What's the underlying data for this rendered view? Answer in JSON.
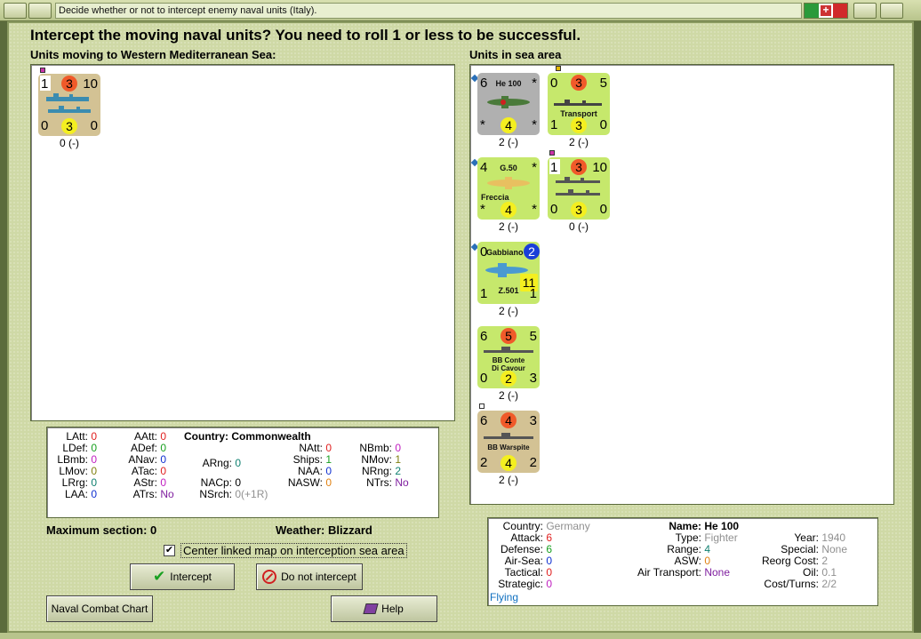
{
  "window": {
    "title": "Decide whether or not to intercept enemy naval units (Italy)."
  },
  "heading": "Intercept the moving naval units?  You need to roll 1 or less to be successful.",
  "left_panel_label": "Units moving to Western Mediterranean Sea:",
  "right_panel_label": "Units in sea area",
  "moving_units": [
    {
      "tl": "1",
      "tc": "3",
      "tr": "10",
      "bl": "0",
      "bc": "3",
      "br": "0",
      "label": "0 (-)"
    }
  ],
  "sea_units": [
    {
      "tl": "6",
      "tc": "",
      "tr": "*",
      "bl": "*",
      "bc": "4",
      "br": "*",
      "name": "He 100",
      "label": "2 (-)"
    },
    {
      "tl": "0",
      "tc": "3",
      "tr": "5",
      "bl": "1",
      "bc": "3",
      "br": "0",
      "name": "Transport",
      "label": "2 (-)"
    },
    {
      "tl": "4",
      "tc": "",
      "tr": "*",
      "bl": "*",
      "bc": "4",
      "br": "*",
      "name": "G.50",
      "name2": "Freccia",
      "label": "2 (-)"
    },
    {
      "tl": "1",
      "tc": "3",
      "tr": "10",
      "bl": "0",
      "bc": "3",
      "br": "0",
      "label": "0 (-)"
    },
    {
      "tl": "0",
      "tc": "2",
      "tr": "",
      "bl": "1",
      "bc": "11",
      "br": "1",
      "name": "Gabbiano",
      "name2": "Z.501",
      "label": "2 (-)"
    },
    {
      "tl": "6",
      "tc": "5",
      "tr": "5",
      "bl": "0",
      "bc": "2",
      "br": "3",
      "name": "BB Conte",
      "name2": "Di Cavour",
      "label": "2 (-)"
    },
    {
      "tl": "6",
      "tc": "4",
      "tr": "3",
      "bl": "2",
      "bc": "4",
      "br": "2",
      "name": "BB Warspite",
      "label": "2 (-)"
    }
  ],
  "summary": {
    "LAtt": "0",
    "LDef": "0",
    "LBmb": "0",
    "LMov": "0",
    "LRrg": "0",
    "LAA": "0",
    "AAtt": "0",
    "ADef": "0",
    "ANav": "0",
    "ATac": "0",
    "AStr": "0",
    "ATrs": "No",
    "country_label": "Country:",
    "country": "Commonwealth",
    "ARng": "0",
    "NACp": "0",
    "NSrch": "0(+1R)",
    "NAtt": "0",
    "Ships": "1",
    "NAA": "0",
    "NASW": "0",
    "NBmb": "0",
    "NMov": "1",
    "NRng": "2",
    "NTrs": "No"
  },
  "max_section": "Maximum section: 0",
  "weather": "Weather:  Blizzard",
  "center_checkbox": {
    "checked": true,
    "label": "Center linked map on interception sea area",
    "mark": "✔"
  },
  "buttons": {
    "intercept": "Intercept",
    "do_not_intercept": "Do not intercept",
    "naval_chart": "Naval Combat Chart",
    "help": "Help"
  },
  "unit_info": {
    "country_label": "Country:",
    "country": "Germany",
    "attack_label": "Attack:",
    "attack": "6",
    "defense_label": "Defense:",
    "defense": "6",
    "airsea_label": "Air-Sea:",
    "airsea": "0",
    "tactical_label": "Tactical:",
    "tactical": "0",
    "strategic_label": "Strategic:",
    "strategic": "0",
    "flying": "Flying",
    "name_label": "Name:",
    "name": "He 100",
    "type_label": "Type:",
    "type": "Fighter",
    "range_label": "Range:",
    "range": "4",
    "asw_label": "ASW:",
    "asw": "0",
    "airtransport_label": "Air Transport:",
    "airtransport": "None",
    "year_label": "Year:",
    "year": "1940",
    "special_label": "Special:",
    "special": "None",
    "reorg_label": "Reorg Cost:",
    "reorg": "2",
    "oil_label": "Oil:",
    "oil": "0.1",
    "cost_label": "Cost/Turns:",
    "cost": "2/2"
  },
  "colors": {
    "panel_bg": "#cfd9a6",
    "accent": "#2a6fb8"
  }
}
